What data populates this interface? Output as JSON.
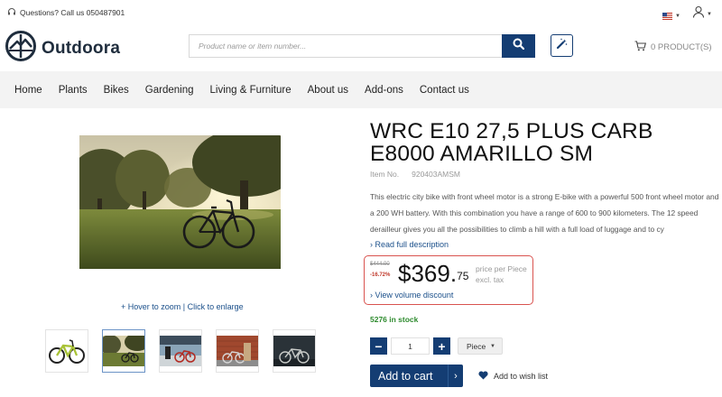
{
  "topbar": {
    "questions": "Questions? Call us 050487901",
    "icons": {
      "headset": "headset-icon",
      "flag": "us-flag-icon",
      "user": "user-icon"
    }
  },
  "header": {
    "logo_text": "Outdoora",
    "search": {
      "placeholder": "Product name or item number...",
      "value": ""
    },
    "cart_label": "0 PRODUCT(S)"
  },
  "nav": {
    "items": [
      "Home",
      "Plants",
      "Bikes",
      "Gardening",
      "Living & Furniture",
      "About us",
      "Add-ons",
      "Contact us"
    ]
  },
  "gallery": {
    "zoom_hint": "+ Hover to zoom | Click to enlarge",
    "active_thumb": 1
  },
  "product": {
    "title": "WRC E10 27,5 PLUS CARB E8000 AMARILLO SM",
    "item_no_label": "Item No.",
    "item_no_value": "920403AMSM",
    "description": "This electric city bike with front wheel motor is a strong E-bike with a powerful 500 front wheel motor and a 200 WH battery. With this combination you have a range of 600 to 900 kilometers. The 12 speed derailleur gives you all the possibilities to climb a hill with a full load of luggage and to cy",
    "read_more": "› Read full description",
    "old_price": "$444.00",
    "discount": "-16.72%",
    "price_main": "$369.",
    "price_cents": "75",
    "price_per": "price per Piece",
    "excl_tax": "excl. tax",
    "volume_discount": "› View volume discount",
    "stock": "5276 in stock",
    "quantity": "1",
    "unit": "Piece",
    "minus": "−",
    "plus": "+",
    "add_to_cart": "Add to cart",
    "add_to_cart_arrow": "›",
    "wishlist": "Add to wish list"
  },
  "colors": {
    "brand": "#143d73",
    "link": "#1a4f8a",
    "discount": "#c0392b",
    "stock": "#2e8b2e",
    "highlight_border": "#d9534f"
  }
}
